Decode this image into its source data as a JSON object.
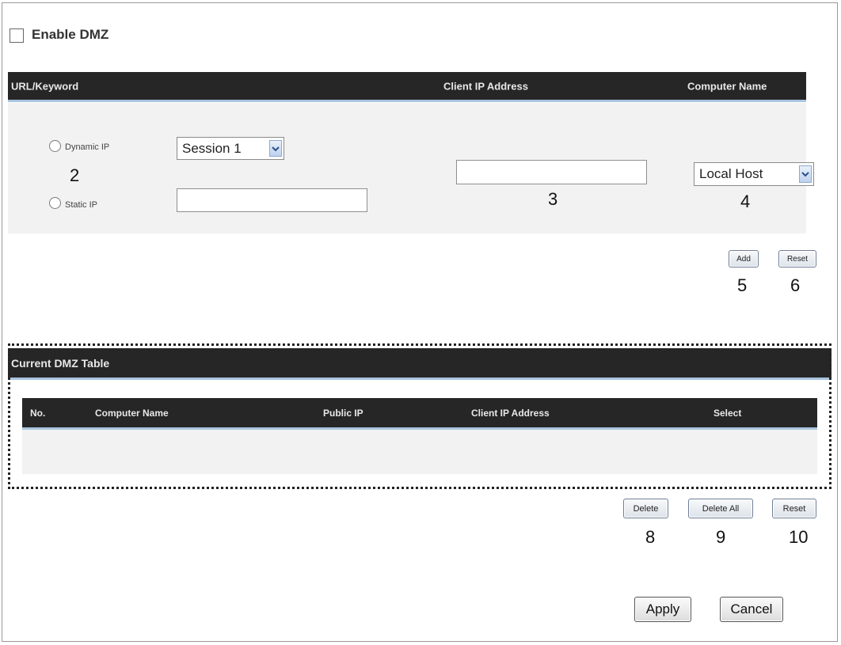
{
  "enable_dmz": {
    "label": "Enable DMZ",
    "checked": false
  },
  "header": {
    "url_keyword": "URL/Keyword",
    "client_ip": "Client IP Address",
    "computer_name": "Computer Name"
  },
  "form": {
    "dynamic_ip_label": "Dynamic IP",
    "static_ip_label": "Static IP",
    "session_select": "Session 1",
    "static_ip_value": "",
    "client_ip_value": "",
    "computer_select": "Local Host"
  },
  "callouts": {
    "n2": "2",
    "n3": "3",
    "n4": "4",
    "n5": "5",
    "n6": "6",
    "n8": "8",
    "n9": "9",
    "n10": "10"
  },
  "buttons": {
    "add": "Add",
    "reset_top": "Reset",
    "delete": "Delete",
    "delete_all": "Delete All",
    "reset_bottom": "Reset",
    "apply": "Apply",
    "cancel": "Cancel"
  },
  "dmz_table": {
    "title": "Current DMZ Table",
    "columns": [
      "No.",
      "Computer Name",
      "Public IP",
      "Client IP Address",
      "Select"
    ],
    "rows": []
  },
  "colors": {
    "header_bg": "#262626",
    "header_accent": "#a9c4de",
    "panel_bg": "#f2f2f2"
  }
}
